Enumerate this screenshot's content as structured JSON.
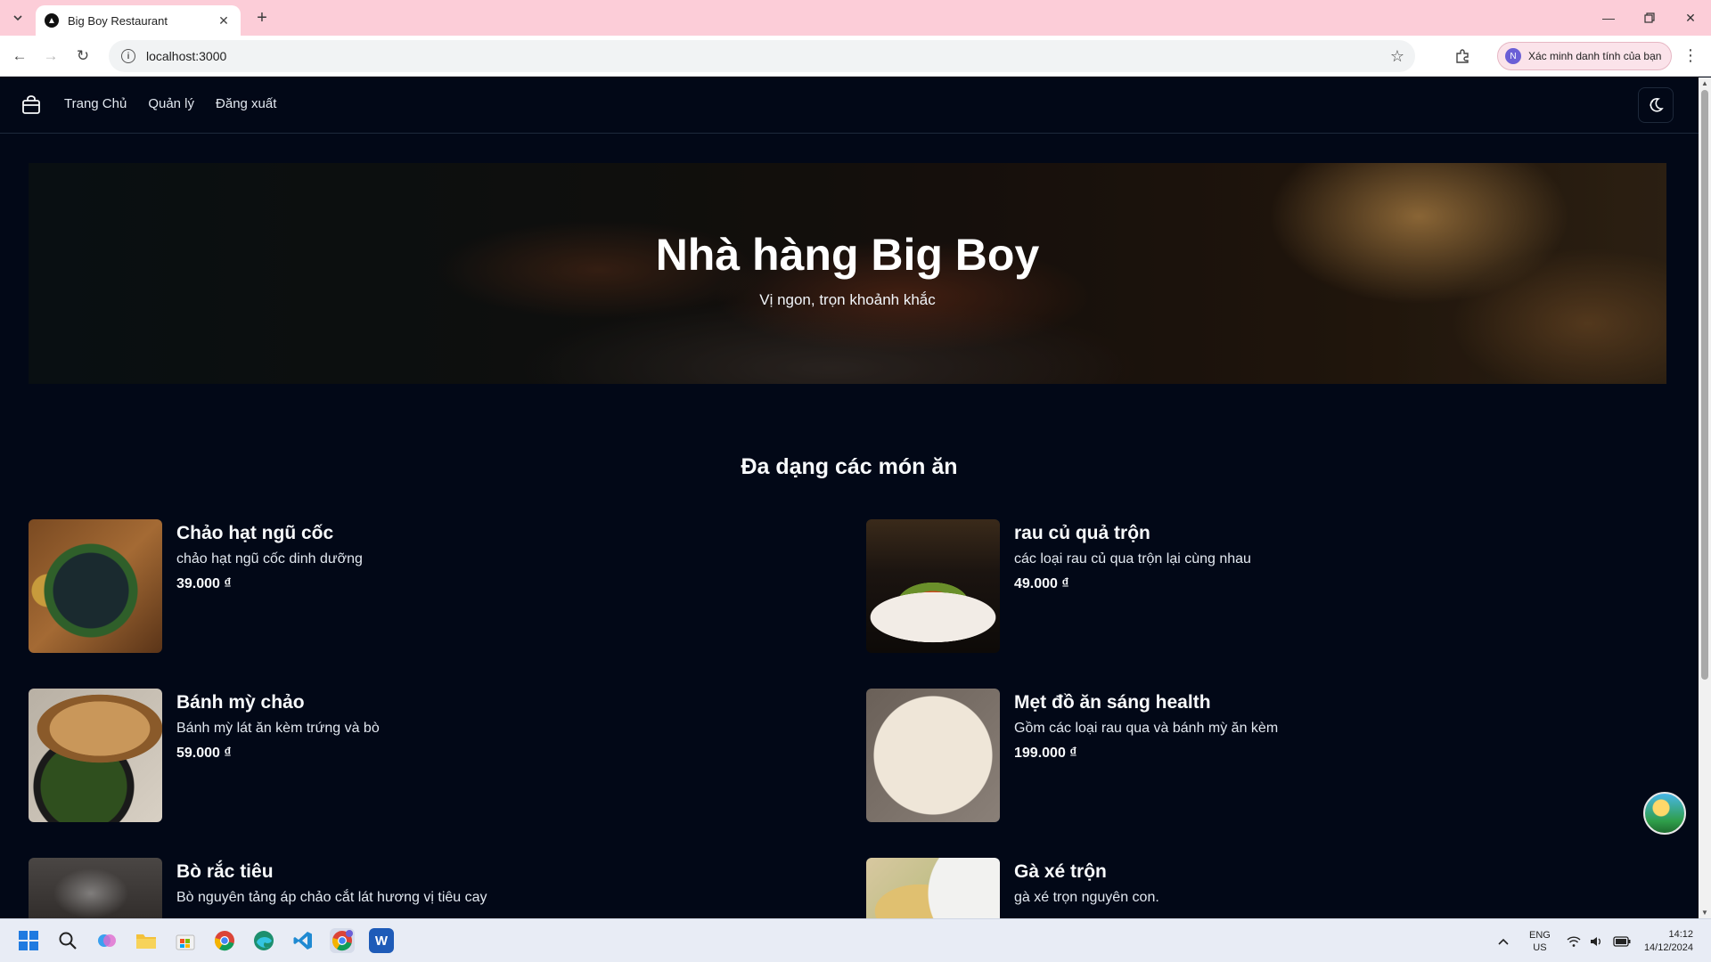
{
  "browser": {
    "tab_title": "Big Boy Restaurant",
    "url": "localhost:3000",
    "profile_label": "Xác minh danh tính của bạn",
    "profile_initial": "N"
  },
  "nav": {
    "items": [
      {
        "label": "Trang Chủ"
      },
      {
        "label": "Quản lý"
      },
      {
        "label": "Đăng xuất"
      }
    ]
  },
  "hero": {
    "title": "Nhà hàng Big Boy",
    "subtitle": "Vị ngon, trọn khoảnh khắc"
  },
  "menu": {
    "section_title": "Đa dạng các món ăn",
    "dishes": [
      {
        "name": "Chảo hạt ngũ cốc",
        "description": "chảo hạt ngũ cốc dinh dưỡng",
        "price": "39.000 ₫"
      },
      {
        "name": "rau củ quả trộn",
        "description": "các loại rau củ qua trộn lại cùng nhau",
        "price": "49.000 ₫"
      },
      {
        "name": "Bánh mỳ chảo",
        "description": "Bánh mỳ lát ăn kèm trứng và bò",
        "price": "59.000 ₫"
      },
      {
        "name": "Mẹt đồ ăn sáng health",
        "description": "Gồm các loại rau qua và bánh mỳ ăn kèm",
        "price": "199.000 ₫"
      },
      {
        "name": "Bò rắc tiêu",
        "description": "Bò nguyên tảng áp chảo cắt lát hương vị tiêu cay",
        "price": ""
      },
      {
        "name": "Gà xé trộn",
        "description": "gà xé trọn nguyên con.",
        "price": ""
      }
    ]
  },
  "taskbar": {
    "lang_top": "ENG",
    "lang_bottom": "US",
    "time": "14:12",
    "date": "14/12/2024",
    "word_label": "W",
    "badge": "N"
  }
}
